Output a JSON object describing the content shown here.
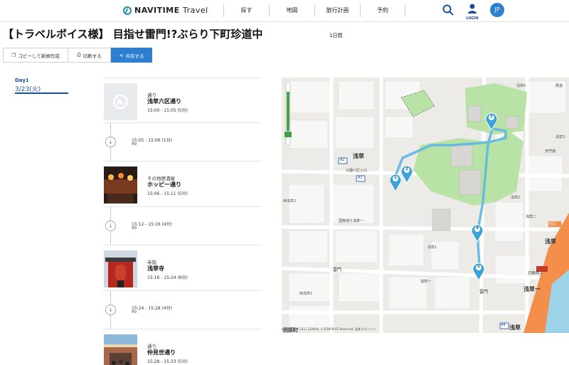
{
  "header": {
    "logo_brand": "NAVITIME",
    "logo_suffix": "Travel",
    "nav": [
      "探す",
      "地図",
      "旅行計画",
      "予約"
    ],
    "login_label": "LOGIN",
    "avatar_initials": "JP"
  },
  "plan": {
    "title": "【トラベルボイス様】 目指せ雷門!?ぶらり下町珍道中",
    "duration": "1日間"
  },
  "actions": {
    "copy_label": "コピーして新規作成",
    "print_label": "印刷する",
    "share_label": "共有する"
  },
  "day": {
    "label": "Day1",
    "date": "3/23(火)"
  },
  "timeline": [
    {
      "kind": "spot",
      "category": "通り",
      "name": "浅草六区通り",
      "time": "15:00 - 15:05 (5分)"
    },
    {
      "kind": "move",
      "time": "15:05 - 15:06 (1分)",
      "fare": "¥0"
    },
    {
      "kind": "spot",
      "category": "その他居酒屋",
      "name": "ホッピー通り",
      "time": "15:06 - 15:11 (5分)"
    },
    {
      "kind": "move",
      "time": "15:12 - 15:16 (4分)",
      "fare": "¥0"
    },
    {
      "kind": "spot",
      "category": "寺院",
      "name": "浅草寺",
      "time": "15:16 - 15:24 (8分)"
    },
    {
      "kind": "move",
      "time": "15:24 - 15:28 (4分)",
      "fare": "¥0"
    },
    {
      "kind": "spot",
      "category": "通り",
      "name": "仲見世通り",
      "time": "15:28 - 15:33 (5分)"
    }
  ],
  "map": {
    "labels": {
      "asakusa_a2": "浅草",
      "asakusa_right": "浅草",
      "asakusa_bottom": "浅草",
      "kaminarimon": "雷門",
      "rokku": "公園六区入口",
      "nishiasakusa2": "西浅草2",
      "nishiasakusa1": "西浅草1",
      "asakusa1": "浅草1",
      "asakusa2": "浅草2",
      "asakusa_itchome": "浅草一",
      "kokusai": "国際通り浅草一",
      "tawaramachi": "田原町",
      "kitaguchi": "北口",
      "seimon": "正面出口",
      "tenmon": "天門通",
      "kaminarimon_east": "雷門",
      "asakusa2_right": "浅草二",
      "asakusa3": "浅草3",
      "asakusa4": "浅草4",
      "station_a2": "A2",
      "station_a1": "A1",
      "station_a4": "A4",
      "station_a5": "A5",
      "bakuro": "馬道",
      "attribution": "地図データ ©2021 ZENRIN, ©ZENRIN AZ Reserved, 画像 ©ゼンリン"
    },
    "markers": [
      "1",
      "2",
      "3",
      "4",
      "5"
    ],
    "route_color": "#5eb8e0",
    "park_color": "#b9e2a6"
  }
}
